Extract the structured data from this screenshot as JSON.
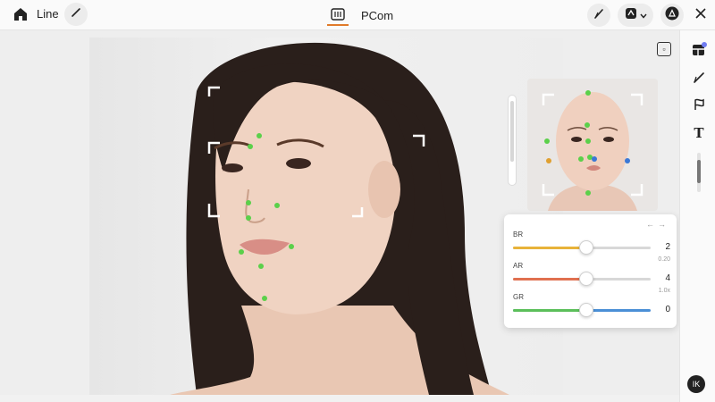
{
  "topbar": {
    "app_name": "Line",
    "document_name": "PCom",
    "icons": [
      "home-icon",
      "pencil-icon",
      "document-icon",
      "brush-icon",
      "layers-icon",
      "chevron-down-icon",
      "share-icon",
      "close-icon"
    ]
  },
  "canvas": {
    "corner_button_icon": "frame-icon"
  },
  "adjust_panel": {
    "nav_prev": "←",
    "nav_next": "→",
    "rows": [
      {
        "label": "BR",
        "meta": "",
        "value": "2",
        "level": 0.53,
        "color": "#e8b33a"
      },
      {
        "label": "AR",
        "meta": "0.20",
        "value": "4",
        "level": 0.53,
        "color": "#e07050"
      },
      {
        "label": "GR",
        "meta": "1.0x",
        "value": "0",
        "level": 0.53,
        "color": "#5bbf5a",
        "color_right": "#4a8fd6"
      }
    ]
  },
  "rail": {
    "icons": [
      "panels-icon",
      "brush-icon",
      "flag-icon",
      "text-icon"
    ],
    "text_tool_glyph": "T",
    "bottom_button": "IK"
  },
  "colors": {
    "accent_tab": "#e07a2a",
    "landmark": "#5bd04a",
    "badge": "#6f7cf0"
  }
}
